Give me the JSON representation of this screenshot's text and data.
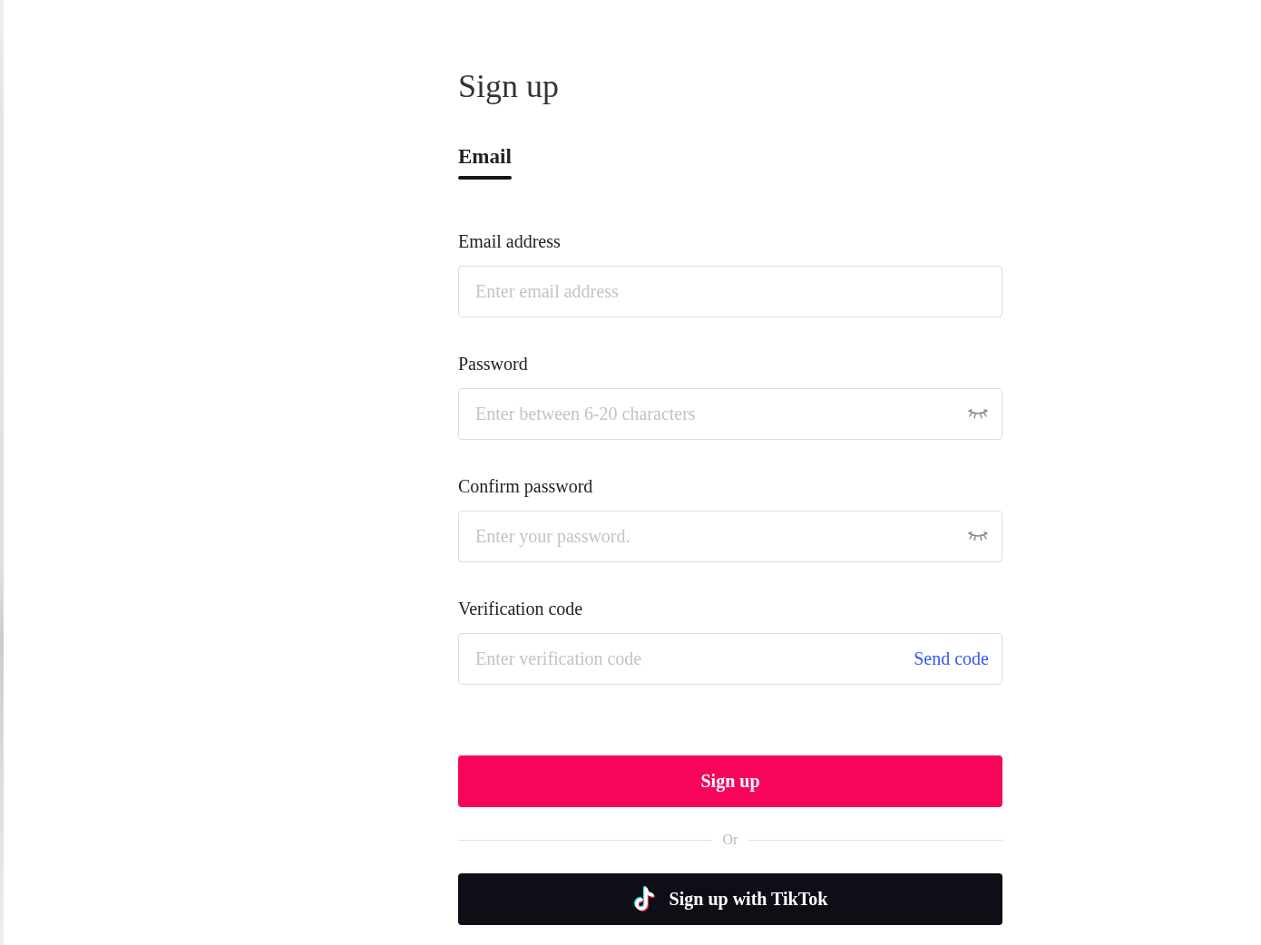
{
  "title": "Sign up",
  "tabs": [
    {
      "label": "Email",
      "selected": true
    }
  ],
  "fields": [
    {
      "label": "Email address",
      "placeholder": "Enter email address",
      "kind": "text"
    },
    {
      "label": "Password",
      "placeholder": "Enter between 6-20 characters",
      "kind": "password"
    },
    {
      "label": "Confirm password",
      "placeholder": "Enter your password.",
      "kind": "password"
    },
    {
      "label": "Verification code",
      "placeholder": "Enter verification code",
      "kind": "code",
      "action": "Send code"
    }
  ],
  "submit": "Sign up",
  "divider": "Or",
  "alt_button": "Sign up with TikTok"
}
